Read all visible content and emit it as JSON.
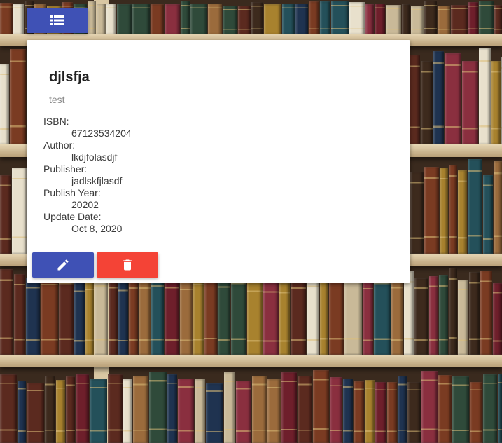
{
  "colors": {
    "primary": "#3f51b5",
    "warn": "#f44336",
    "card_bg": "#ffffff"
  },
  "toolbar": {
    "menu_icon": "list-icon"
  },
  "book": {
    "title": "djlsfja",
    "subtitle": "test",
    "fields": [
      {
        "label": "ISBN:",
        "value": "67123534204"
      },
      {
        "label": "Author:",
        "value": "lkdjfolasdjf"
      },
      {
        "label": "Publisher:",
        "value": "jadlskfjlasdf"
      },
      {
        "label": "Publish Year:",
        "value": "20202"
      },
      {
        "label": "Update Date:",
        "value": "Oct 8, 2020"
      }
    ]
  },
  "actions": {
    "edit_icon": "pencil-icon",
    "delete_icon": "trash-icon"
  }
}
